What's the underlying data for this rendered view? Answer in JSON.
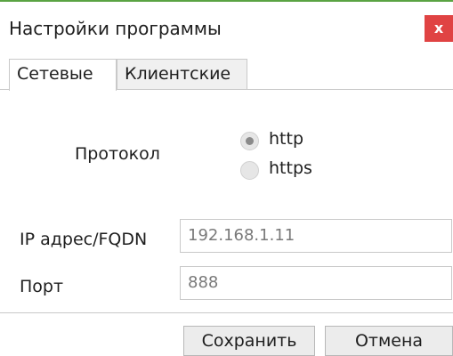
{
  "window": {
    "title": "Настройки программы",
    "close_label": "x"
  },
  "tabs": [
    {
      "label": "Сетевые",
      "active": true
    },
    {
      "label": "Клиентские",
      "active": false
    }
  ],
  "protocol": {
    "label": "Протокол",
    "options": [
      {
        "label": "http",
        "selected": true
      },
      {
        "label": "https",
        "selected": false
      }
    ]
  },
  "fields": {
    "ip": {
      "label": "IP адрес/FQDN",
      "value": "192.168.1.11"
    },
    "port": {
      "label": "Порт",
      "value": "888"
    }
  },
  "buttons": {
    "save": "Сохранить",
    "cancel": "Отмена"
  },
  "colors": {
    "accent": "#5aa343",
    "close": "#e04343"
  }
}
